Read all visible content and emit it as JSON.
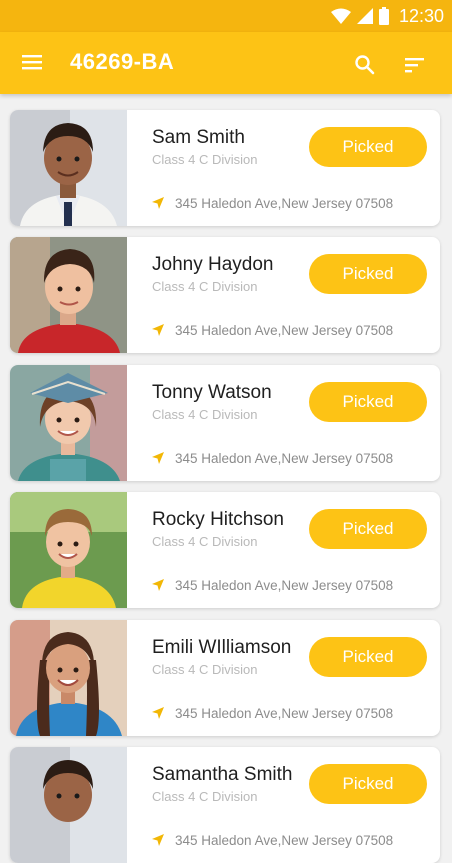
{
  "status": {
    "time": "12:30"
  },
  "appbar": {
    "title": "46269-BA"
  },
  "icons": {
    "menu": "menu-icon",
    "search": "search-icon",
    "sort": "sort-icon",
    "location": "navigation-arrow-icon",
    "wifi": "wifi-icon",
    "signal": "signal-icon",
    "battery": "battery-icon"
  },
  "colors": {
    "status_bar": "#f5b50f",
    "app_bar": "#fdc315",
    "accent": "#fdc315",
    "background": "#f1f1f1"
  },
  "students": [
    {
      "name": "Sam Smith",
      "class_label": "Class 4 C Division",
      "button_label": "Picked",
      "address": "345 Haledon Ave,New Jersey 07508"
    },
    {
      "name": "Johny Haydon",
      "class_label": "Class 4 C Division",
      "button_label": "Picked",
      "address": "345 Haledon Ave,New Jersey 07508"
    },
    {
      "name": "Tonny Watson",
      "class_label": "Class 4 C Division",
      "button_label": "Picked",
      "address": "345 Haledon Ave,New Jersey 07508"
    },
    {
      "name": "Rocky Hitchson",
      "class_label": "Class 4 C Division",
      "button_label": "Picked",
      "address": "345 Haledon Ave,New Jersey 07508"
    },
    {
      "name": "Emili WIlliamson",
      "class_label": "Class 4 C Division",
      "button_label": "Picked",
      "address": "345 Haledon Ave,New Jersey 07508"
    },
    {
      "name": "Samantha Smith",
      "class_label": "Class 4 C Division",
      "button_label": "Picked",
      "address": "345 Haledon Ave,New Jersey 07508"
    }
  ]
}
